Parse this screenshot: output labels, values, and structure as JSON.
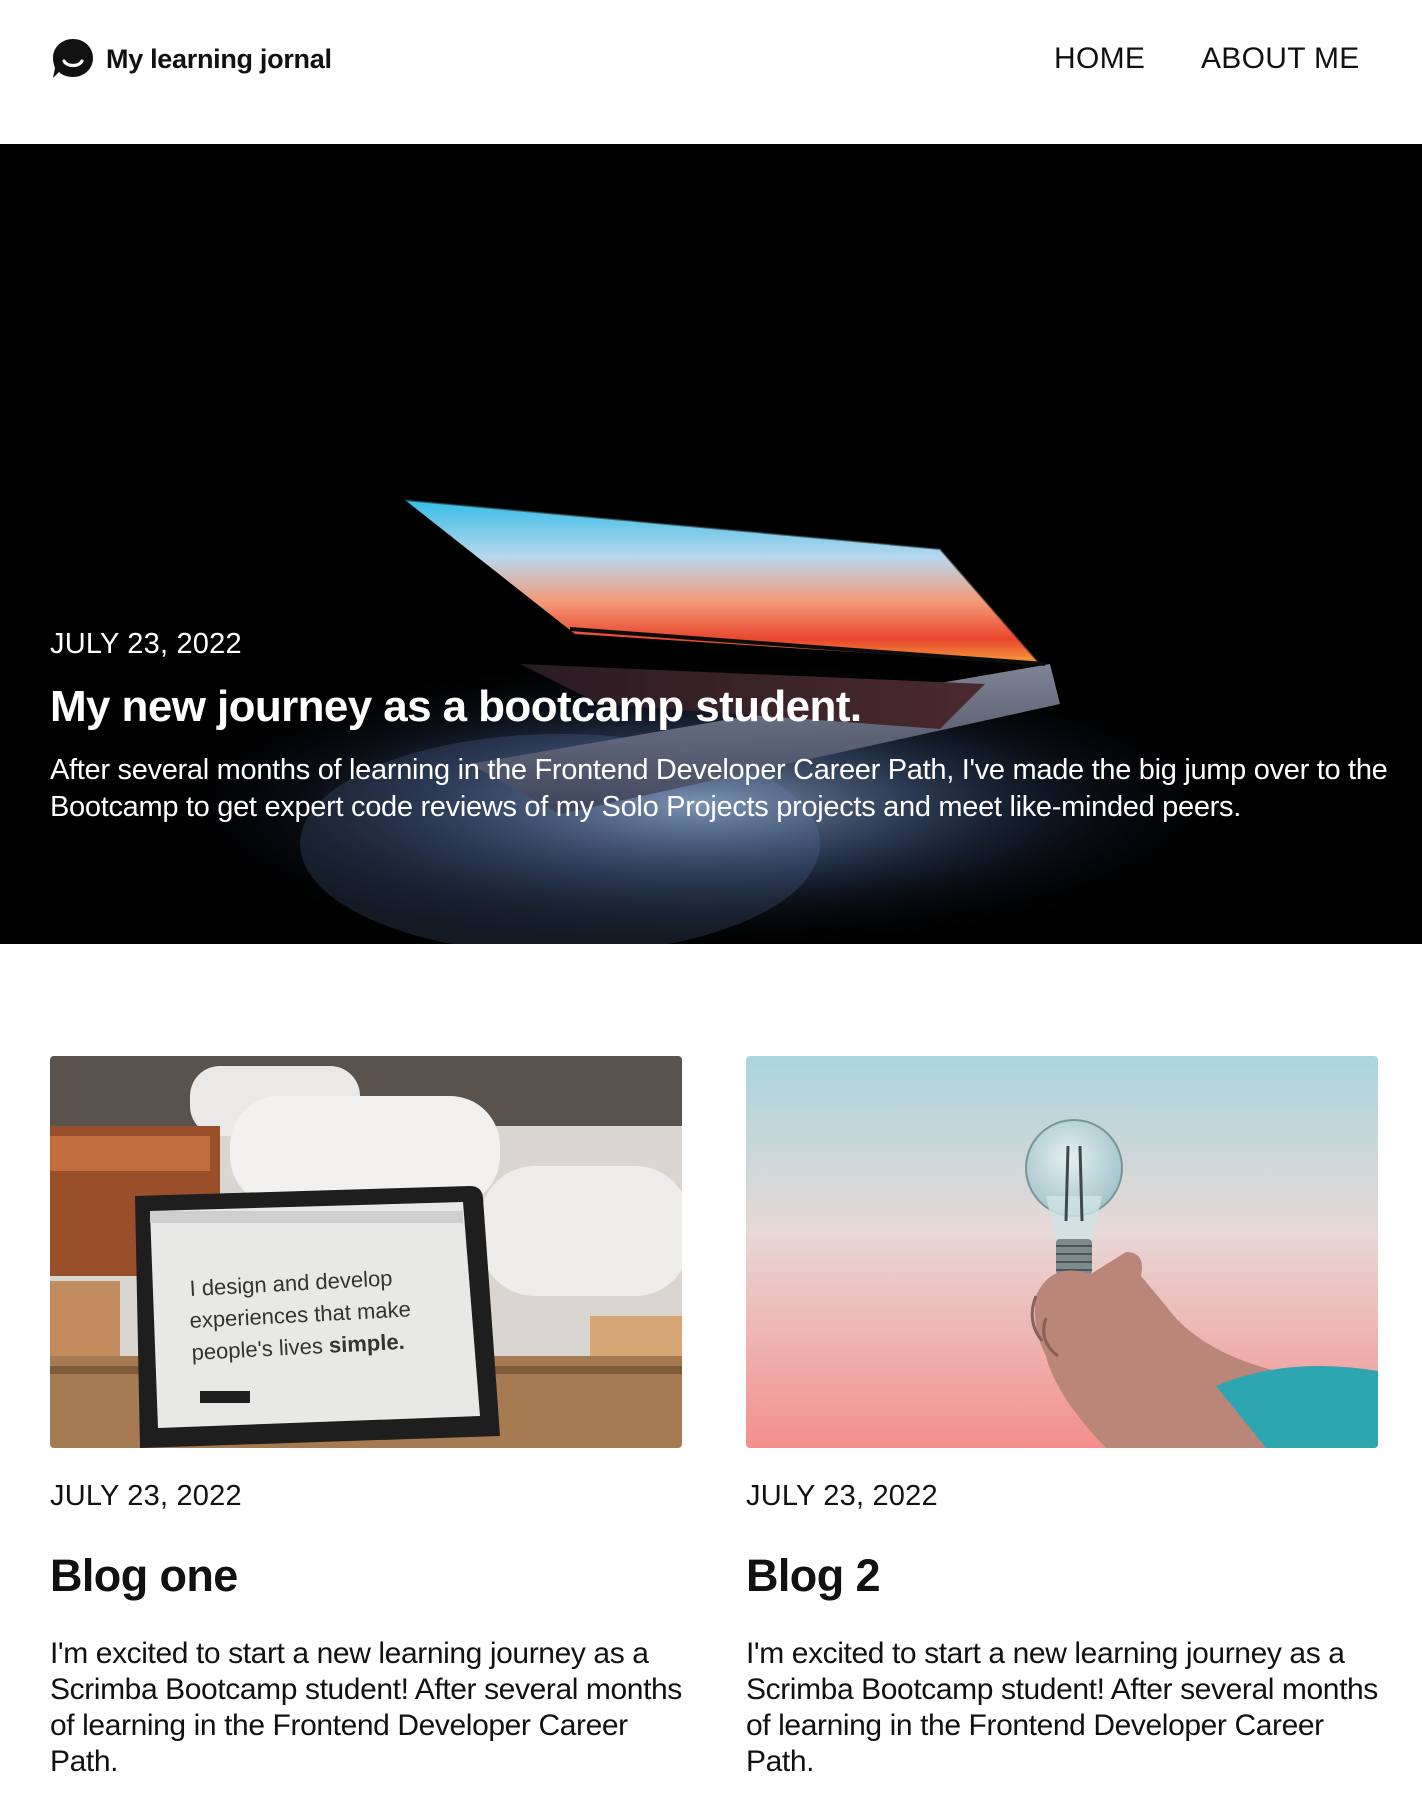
{
  "header": {
    "brand_name": "My learning jornal",
    "brand_icon": "chat-smile-icon",
    "nav": [
      {
        "label": "HOME"
      },
      {
        "label": "ABOUT ME"
      }
    ]
  },
  "hero": {
    "date": "JULY 23, 2022",
    "title": "My new journey as a bootcamp student.",
    "excerpt": "After several months of learning in the Frontend Developer Career Path, I've made the big jump over to the Bootcamp to get expert code reviews of my Solo Projects projects and meet like-minded peers.",
    "image": "laptop-in-dark-image"
  },
  "posts": [
    {
      "image": "laptop-on-desk-image",
      "image_text": "I design and develop experiences that make people's lives simple.",
      "date": "JULY 23, 2022",
      "title": "Blog one",
      "excerpt": "I'm excited to start a new learning journey as a Scrimba Bootcamp student! After several months of learning in the Frontend Developer Career Path."
    },
    {
      "image": "lightbulb-in-hand-image",
      "date": "JULY 23, 2022",
      "title": "Blog 2",
      "excerpt": "I'm excited to start a new learning journey as a Scrimba Bootcamp student! After several months of learning in the Frontend Developer Career Path."
    }
  ],
  "colors": {
    "text": "#111111",
    "hero_background": "#000000",
    "hero_text": "#ffffff",
    "screen_cyan": "#3ec3e6",
    "screen_orange": "#f07a3a",
    "sky_top": "#a9d6dc",
    "sky_bottom": "#f48f8c"
  }
}
